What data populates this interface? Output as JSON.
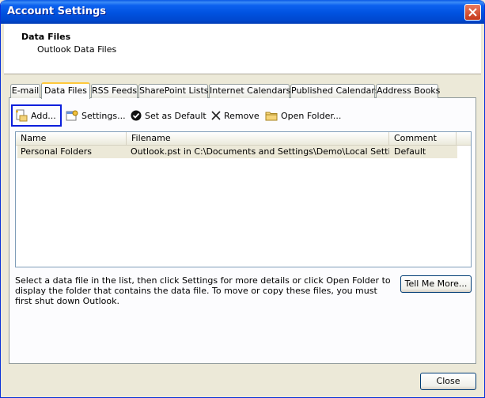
{
  "window": {
    "title": "Account Settings"
  },
  "header": {
    "title": "Data Files",
    "subtitle": "Outlook Data Files"
  },
  "tabs": [
    {
      "label": "E-mail"
    },
    {
      "label": "Data Files"
    },
    {
      "label": "RSS Feeds"
    },
    {
      "label": "SharePoint Lists"
    },
    {
      "label": "Internet Calendars"
    },
    {
      "label": "Published Calendars"
    },
    {
      "label": "Address Books"
    }
  ],
  "toolbar": {
    "add": "Add...",
    "settings": "Settings...",
    "set_default": "Set as Default",
    "remove": "Remove",
    "open_folder": "Open Folder..."
  },
  "list": {
    "columns": [
      "Name",
      "Filename",
      "Comment"
    ],
    "rows": [
      {
        "name": "Personal Folders",
        "filename": "Outlook.pst in C:\\Documents and Settings\\Demo\\Local Settings...",
        "comment": "Default"
      }
    ]
  },
  "description": "Select a data file in the list, then click Settings for more details or click Open Folder to display the folder that contains the data file. To move or copy these files, you must first shut down Outlook.",
  "buttons": {
    "tell_me_more": "Tell Me More...",
    "close": "Close"
  }
}
